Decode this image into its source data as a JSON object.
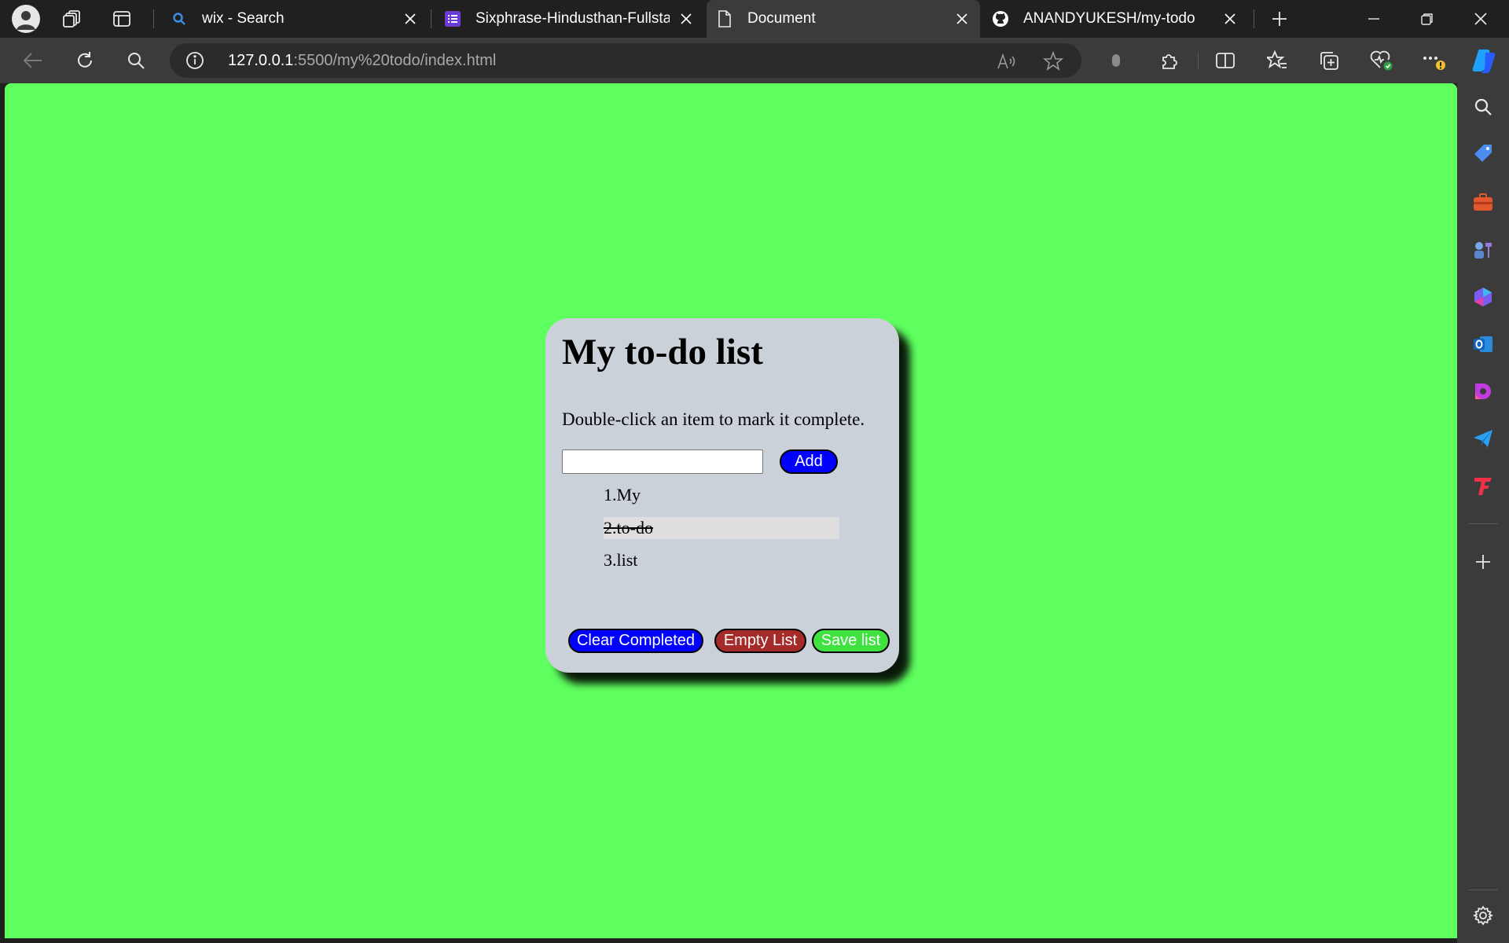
{
  "tabs": [
    {
      "title": "wix - Search",
      "icon": "search-favicon-icon",
      "active": false
    },
    {
      "title": "Sixphrase-Hindusthan-Fullstack",
      "icon": "form-favicon-icon",
      "active": false
    },
    {
      "title": "Document",
      "icon": "document-favicon-icon",
      "active": true
    },
    {
      "title": "ANANDYUKESH/my-todo",
      "icon": "github-favicon-icon",
      "active": false
    }
  ],
  "address": {
    "host": "127.0.0.1",
    "rest": ":5500/my%20todo/index.html"
  },
  "page": {
    "title": "My to-do list",
    "instructions": "Double-click an item to mark it complete.",
    "input_value": "",
    "add_label": "Add",
    "items": [
      {
        "label": "1.My",
        "completed": false
      },
      {
        "label": "2.to-do",
        "completed": true
      },
      {
        "label": "3.list",
        "completed": false
      }
    ],
    "buttons": {
      "clear_completed": "Clear Completed",
      "empty_list": "Empty List",
      "save_list": "Save list"
    }
  },
  "colors": {
    "page_background": "#5fff5f",
    "card_background": "#cbd1d9",
    "add_button": "#0000ff",
    "clear_button": "#0000ff",
    "empty_button": "#a52a2a",
    "save_button": "#3fe23f"
  }
}
